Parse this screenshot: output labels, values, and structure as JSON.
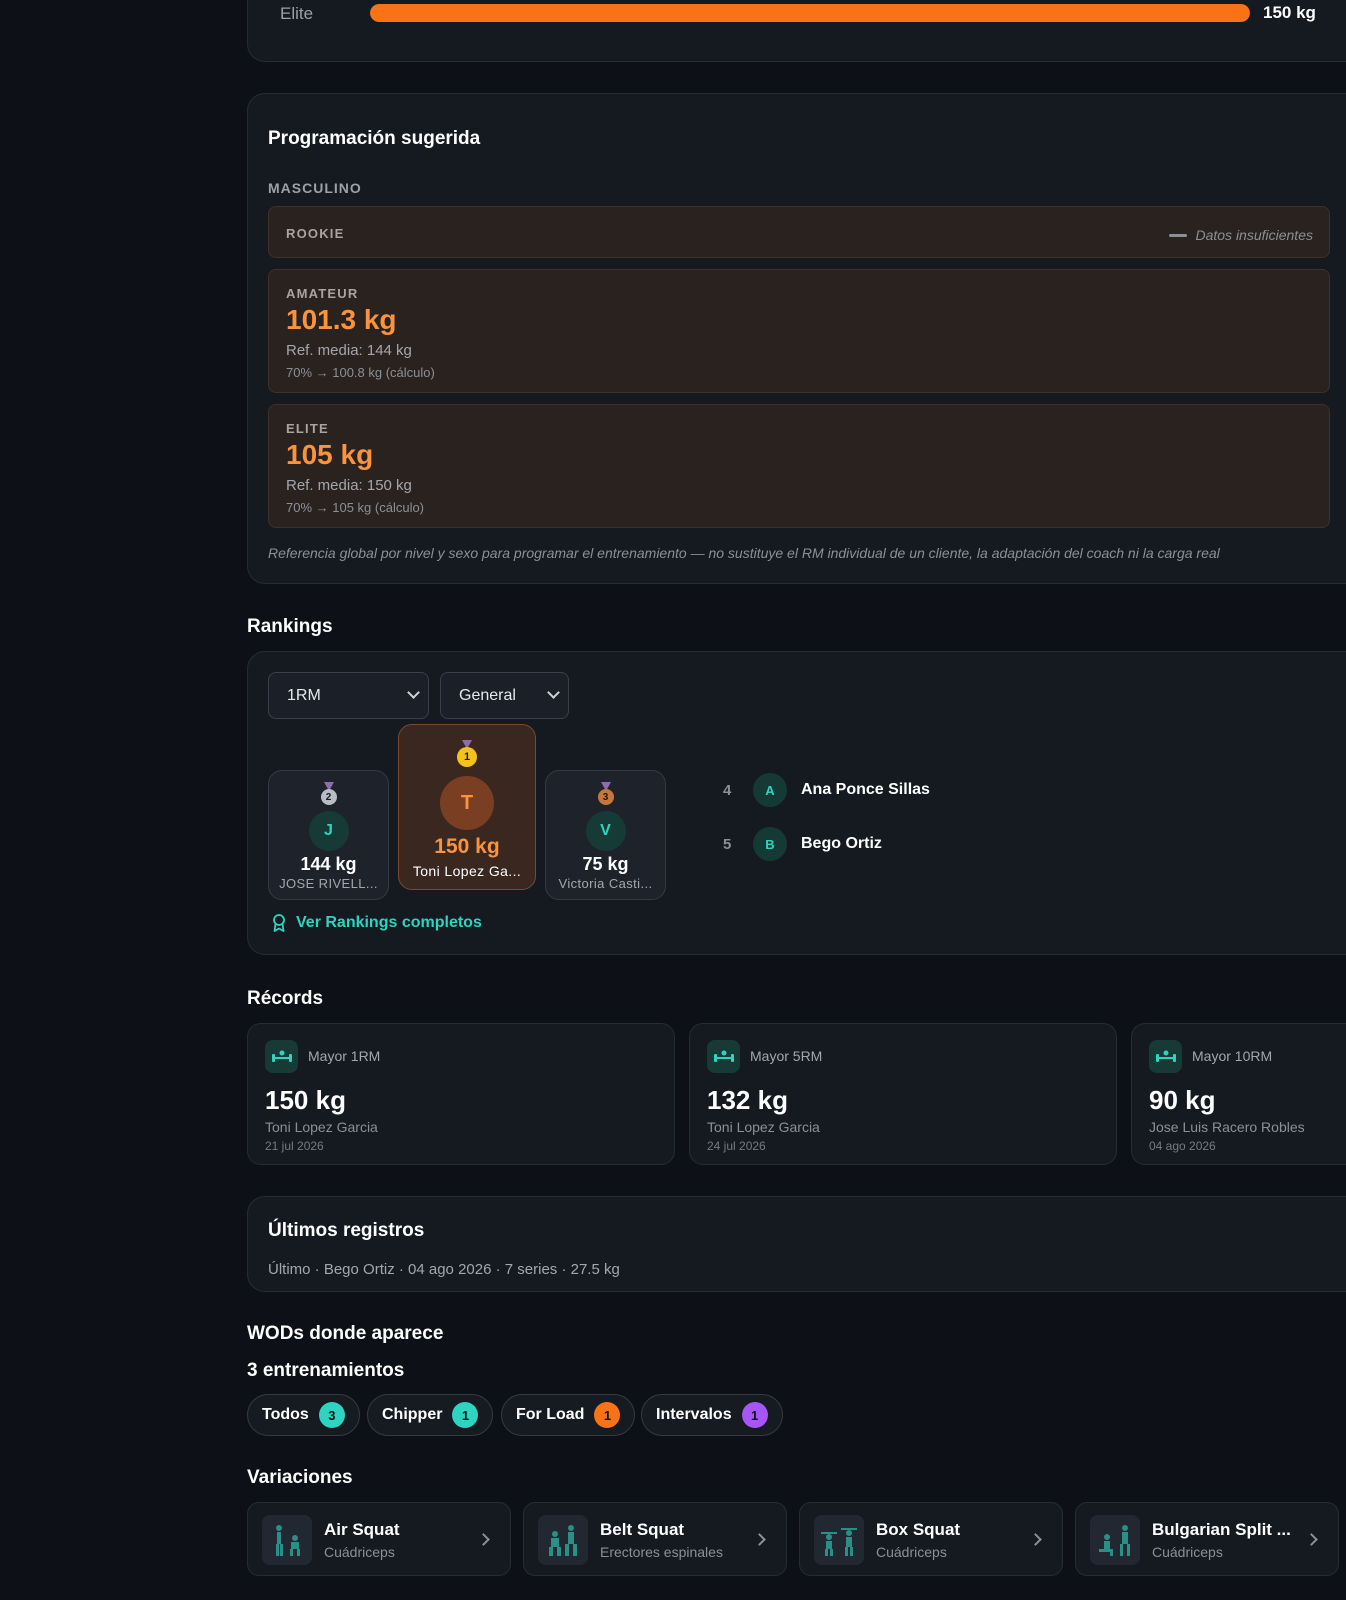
{
  "top_progress": {
    "label": "Elite",
    "value": "150 kg",
    "fill_fraction": 1.0,
    "color": "#f97316"
  },
  "programacion": {
    "title": "Programación sugerida",
    "section": "MASCULINO",
    "levels": [
      {
        "name": "ROOKIE",
        "status": "Datos insuficientes"
      },
      {
        "name": "AMATEUR",
        "value": "101.3 kg",
        "ref": "Ref. media: 144 kg",
        "calc": "70% → 100.8 kg (cálculo)"
      },
      {
        "name": "ELITE",
        "value": "105 kg",
        "ref": "Ref. media: 150 kg",
        "calc": "70% → 105 kg (cálculo)"
      }
    ],
    "note": "Referencia global por nivel y sexo para programar el entrenamiento — no sustituye el RM individual de un cliente, la adaptación del coach ni la carga real"
  },
  "rankings": {
    "title": "Rankings",
    "metric_select": "1RM",
    "group_select": "General",
    "podium": [
      {
        "place": "2",
        "initial": "J",
        "value": "144 kg",
        "name": "JOSE RIVELL..."
      },
      {
        "place": "1",
        "initial": "T",
        "value": "150 kg",
        "name": "Toni Lopez Ga..."
      },
      {
        "place": "3",
        "initial": "V",
        "value": "75 kg",
        "name": "Victoria Casti..."
      }
    ],
    "list": [
      {
        "pos": "4",
        "initial": "A",
        "name": "Ana Ponce Sillas"
      },
      {
        "pos": "5",
        "initial": "B",
        "name": "Bego Ortiz"
      }
    ],
    "link": "Ver Rankings completos"
  },
  "records": {
    "title": "Récords",
    "items": [
      {
        "label": "Mayor 1RM",
        "value": "150 kg",
        "who": "Toni Lopez Garcia",
        "date": "21 jul 2026"
      },
      {
        "label": "Mayor 5RM",
        "value": "132 kg",
        "who": "Toni Lopez Garcia",
        "date": "24 jul 2026"
      },
      {
        "label": "Mayor 10RM",
        "value": "90 kg",
        "who": "Jose Luis Racero Robles",
        "date": "04 ago 2026"
      }
    ]
  },
  "ultimos": {
    "title": "Últimos registros",
    "line": "Último · Bego Ortiz · 04 ago 2026 · 7 series · 27.5 kg"
  },
  "wods": {
    "title": "WODs donde aparece",
    "count_text": "3 entrenamientos",
    "chips": [
      {
        "label": "Todos",
        "count": "3",
        "color": "#2dd4bf"
      },
      {
        "label": "Chipper",
        "count": "1",
        "color": "#2dd4bf"
      },
      {
        "label": "For Load",
        "count": "1",
        "color": "#f97316"
      },
      {
        "label": "Intervalos",
        "count": "1",
        "color": "#a855f7"
      }
    ]
  },
  "variaciones": {
    "title": "Variaciones",
    "items": [
      {
        "name": "Air Squat",
        "muscle": "Cuádriceps"
      },
      {
        "name": "Belt Squat",
        "muscle": "Erectores espinales"
      },
      {
        "name": "Box Squat",
        "muscle": "Cuádriceps"
      },
      {
        "name": "Bulgarian Split ...",
        "muscle": "Cuádriceps"
      }
    ]
  }
}
